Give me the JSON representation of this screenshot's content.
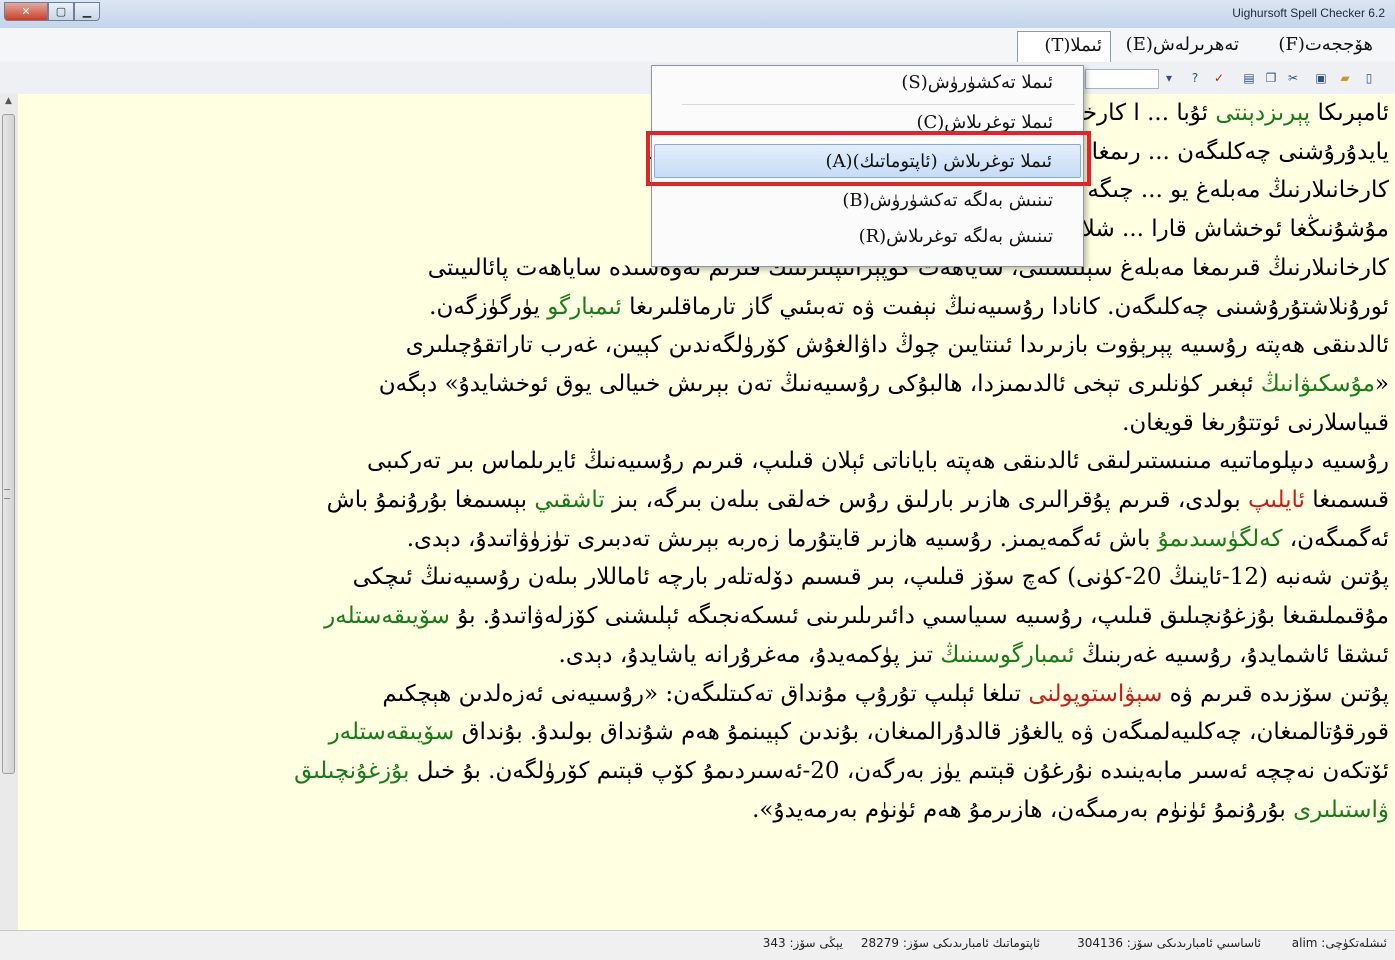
{
  "window": {
    "title": "Uighursoft Spell Checker 6.2"
  },
  "menubar": {
    "items": [
      {
        "label": "ھۆججەت(F)"
      },
      {
        "label": "تەھرىرلەش(E)"
      },
      {
        "label": "ئىملا(T)"
      }
    ]
  },
  "dropdown": {
    "items": [
      {
        "label": "ئىملا تەكشۈرۈش(S)"
      },
      {
        "label": "ئىملا توغرىلاش(C)"
      },
      {
        "label": "ئىملا توغرىلاش (ئاپتوماتىك)(A)"
      },
      {
        "label": "تىنىش بەلگە تەكشۈرۈش(B)"
      },
      {
        "label": "تىنىش بەلگە توغرىلاش(R)"
      }
    ]
  },
  "document": {
    "lines": [
      [
        {
          "t": "ئامېرىكا "
        },
        {
          "t": "پېرىزدېنتى",
          "c": "g"
        },
        {
          "t": " ئۇبا ... ا كارخانىلىرىنىڭ قىرىمدا "
        },
        {
          "t": "كەسپىي",
          "c": "g"
        },
        {
          "t": " ئىشلارنى قانات"
        }
      ],
      [
        {
          "t": "يايدۇرۇشنى چەكلىگەن ... رىمغا بولغان ئىمپورت، "
        },
        {
          "t": "ئېكىسپورت",
          "c": "g"
        },
        {
          "t": " سودىسى، يەرلىك"
        }
      ],
      [
        {
          "t": "كارخانىلارنىڭ مەبلەغ يو ... چىگە ئالدىكەن. "
        },
        {
          "t": "ياۋرۇپا",
          "c": "g"
        },
        {
          "t": " ئىتتىپاقىمۇ بۇنىڭدىن بۇرۇن"
        }
      ],
      [
        {
          "t": "مۇشۇنىڭغا ئوخشاش قارا ... شلاپ كۆچكە ئىگە بولغان. "
        },
        {
          "t": "ياۋرۇپا",
          "c": "g"
        },
        {
          "t": " ئىتتىپاقى"
        }
      ],
      [
        {
          "t": "كارخانىلارنىڭ قىرىمغا مەبلەغ سېلىشىنى، ساياھەت كوپېراتىپلىرىنىڭ قىرىم تەۋەسىدە ساياھەت پائالىيىتى"
        }
      ],
      [
        {
          "t": "ئورۇنلاشتۇرۇشىنى چەكلىگەن. كانادا رۇسىيەنىڭ نېفىت ۋە تەبىئىي گاز تارماقلىرىغا "
        },
        {
          "t": "ئىمبارگو",
          "c": "g"
        },
        {
          "t": " يۈرگۈزگەن."
        }
      ],
      [
        {
          "t": "ئالدىنقى ھەپتە رۇسىيە پېرېۋوت بازىرىدا ئىنتايىن چوڭ داۋالغۇش كۆرۈلگەندىن كېيىن، غەرب تاراتقۇچىلىرى"
        }
      ],
      [
        {
          "t": "«"
        },
        {
          "t": "مۇسكىۋانىڭ",
          "c": "g"
        },
        {
          "t": " ئېغىر كۈنلىرى تېخى ئالدىمىزدا، ھالبۇكى رۇسىيەنىڭ تەن بېرىش خىيالى يوق ئوخشايدۇ» دېگەن"
        }
      ],
      [
        {
          "t": "قىياسلارنى ئوتتۇرىغا قويغان."
        }
      ],
      [
        {
          "t": "رۇسىيە دىپلوماتىيە مىنىستىرلىقى ئالدىنقى ھەپتە باياناتى ئېلان قىلىپ، قىرىم رۇسىيەنىڭ ئايرىلماس بىر تەركىبى"
        }
      ],
      [
        {
          "t": "قىسمىغا "
        },
        {
          "t": "ئايلىپ",
          "c": "r"
        },
        {
          "t": " بولدى، قىرىم پۇقرالىرى ھازىر بارلىق رۇس خەلقى بىلەن بىرگە، بىز "
        },
        {
          "t": "تاشقىي",
          "c": "g"
        },
        {
          "t": " بېسىمغا بۇرۇنمۇ باش"
        }
      ],
      [
        {
          "t": "ئەگمىگەن، "
        },
        {
          "t": "كەلگۈسىدىمۇ",
          "c": "g"
        },
        {
          "t": " باش ئەگمەيمىز. رۇسىيە ھازىر قايتۇرما زەربە بېرىش تەدبىرى تۈزۈۋاتىدۇ، دېدى."
        }
      ],
      [
        {
          "t": "پۇتىن شەنبە (12-ئاينىڭ 20-كۈنى) كەچ سۆز قىلىپ، بىر قىسىم دۆلەتلەر بارچە ئاماللار بىلەن رۇسىيەنىڭ ئىچكى"
        }
      ],
      [
        {
          "t": "مۇقىملىقىغا بۇزغۇنچىلىق قىلىپ، رۇسىيە سىياسىي دائىرىلىرىنى ئىسكەنجىگە ئېلىشنى كۆزلەۋاتىدۇ. بۇ "
        },
        {
          "t": "سۆيىقەستلەر",
          "c": "g"
        }
      ],
      [
        {
          "t": "ئىشقا ئاشمايدۇ، رۇسىيە غەربنىڭ "
        },
        {
          "t": "ئىمبارگوسىنىڭ",
          "c": "g"
        },
        {
          "t": " تىز پۈكمەيدۇ، مەغرۇرانە ياشايدۇ، دېدى."
        }
      ],
      [
        {
          "t": "پۇتىن سۆزىدە قىرىم ۋە "
        },
        {
          "t": "سېۋاستوپولنى",
          "c": "r"
        },
        {
          "t": " تىلغا ئېلىپ تۇرۇپ مۇنداق تەكىتلىگەن: «رۇسىيەنى ئەزەلدىن ھېچكىم"
        }
      ],
      [
        {
          "t": "قورقۇتالمىغان، چەكلىيەلمىگەن ۋە يالغۇز قالدۇرالمىغان، بۇندىن كېيىنمۇ ھەم شۇنداق بولىدۇ. بۇنداق "
        },
        {
          "t": "سۆيىقەستلەر",
          "c": "g"
        }
      ],
      [
        {
          "t": "ئۆتكەن نەچچە ئەسىر مابەينىدە نۇرغۇن قېتىم يۈز بەرگەن، 20-ئەسىردىمۇ كۆپ قېتىم كۆرۈلگەن. بۇ خىل "
        },
        {
          "t": "بۇزغۇنچىلىق",
          "c": "g"
        }
      ],
      [
        {
          "t": ""
        },
        {
          "t": "ۋاستىلىرى",
          "c": "g"
        },
        {
          "t": " بۇرۇنمۇ ئۈنۈم بەرمىگەن، ھازىرمۇ ھەم ئۈنۈم بەرمەيدۇ»."
        }
      ]
    ]
  },
  "statusbar": {
    "dictionary_user": "ئىشلەتكۈچى: alim",
    "basic_words": "ئاساسىي ئامبارىدىكى سۆز: 304136",
    "auto_words": "ئاپتوماتىك ئامبارىدىكى سۆز: 28279",
    "new_words": "يېڭى سۆز: 343"
  },
  "toolbar": {
    "zoom_value": ""
  }
}
